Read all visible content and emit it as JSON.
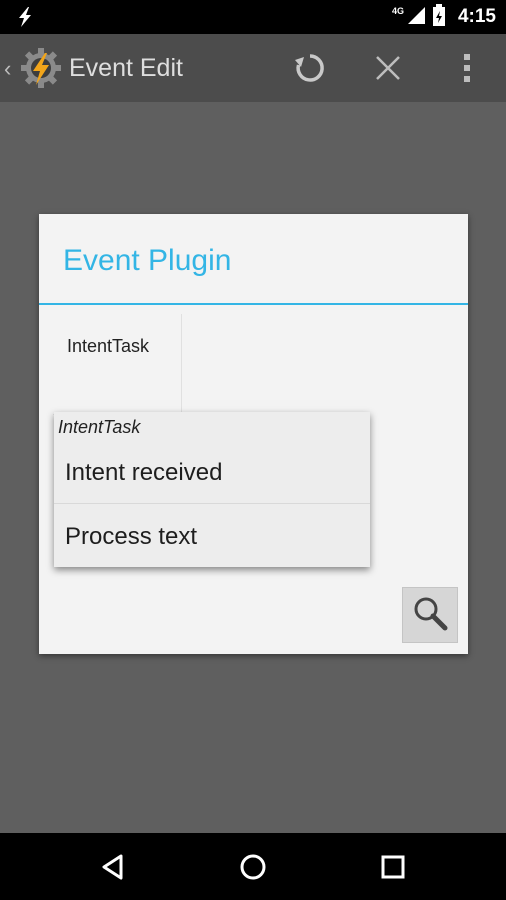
{
  "status_bar": {
    "network": "4G",
    "time": "4:15"
  },
  "action_bar": {
    "title": "Event Edit",
    "back_icon": "back-caret-icon",
    "app_icon": "tasker-app-icon",
    "actions": [
      "undo-icon",
      "close-icon",
      "overflow-menu-icon"
    ]
  },
  "dialog": {
    "title": "Event Plugin",
    "accent_color": "#33b5e5",
    "plugin_tile": {
      "label": "IntentTask",
      "icon": "intenttask-plugin-icon"
    },
    "search_button_icon": "search-icon"
  },
  "popup": {
    "header": "IntentTask",
    "items": [
      {
        "label": "Intent received",
        "icon": "intenttask-plugin-icon"
      },
      {
        "label": "Process text",
        "icon": "intenttask-plugin-icon"
      }
    ]
  },
  "nav_bar": {
    "buttons": [
      "back-triangle-icon",
      "home-circle-icon",
      "recents-square-icon"
    ]
  }
}
